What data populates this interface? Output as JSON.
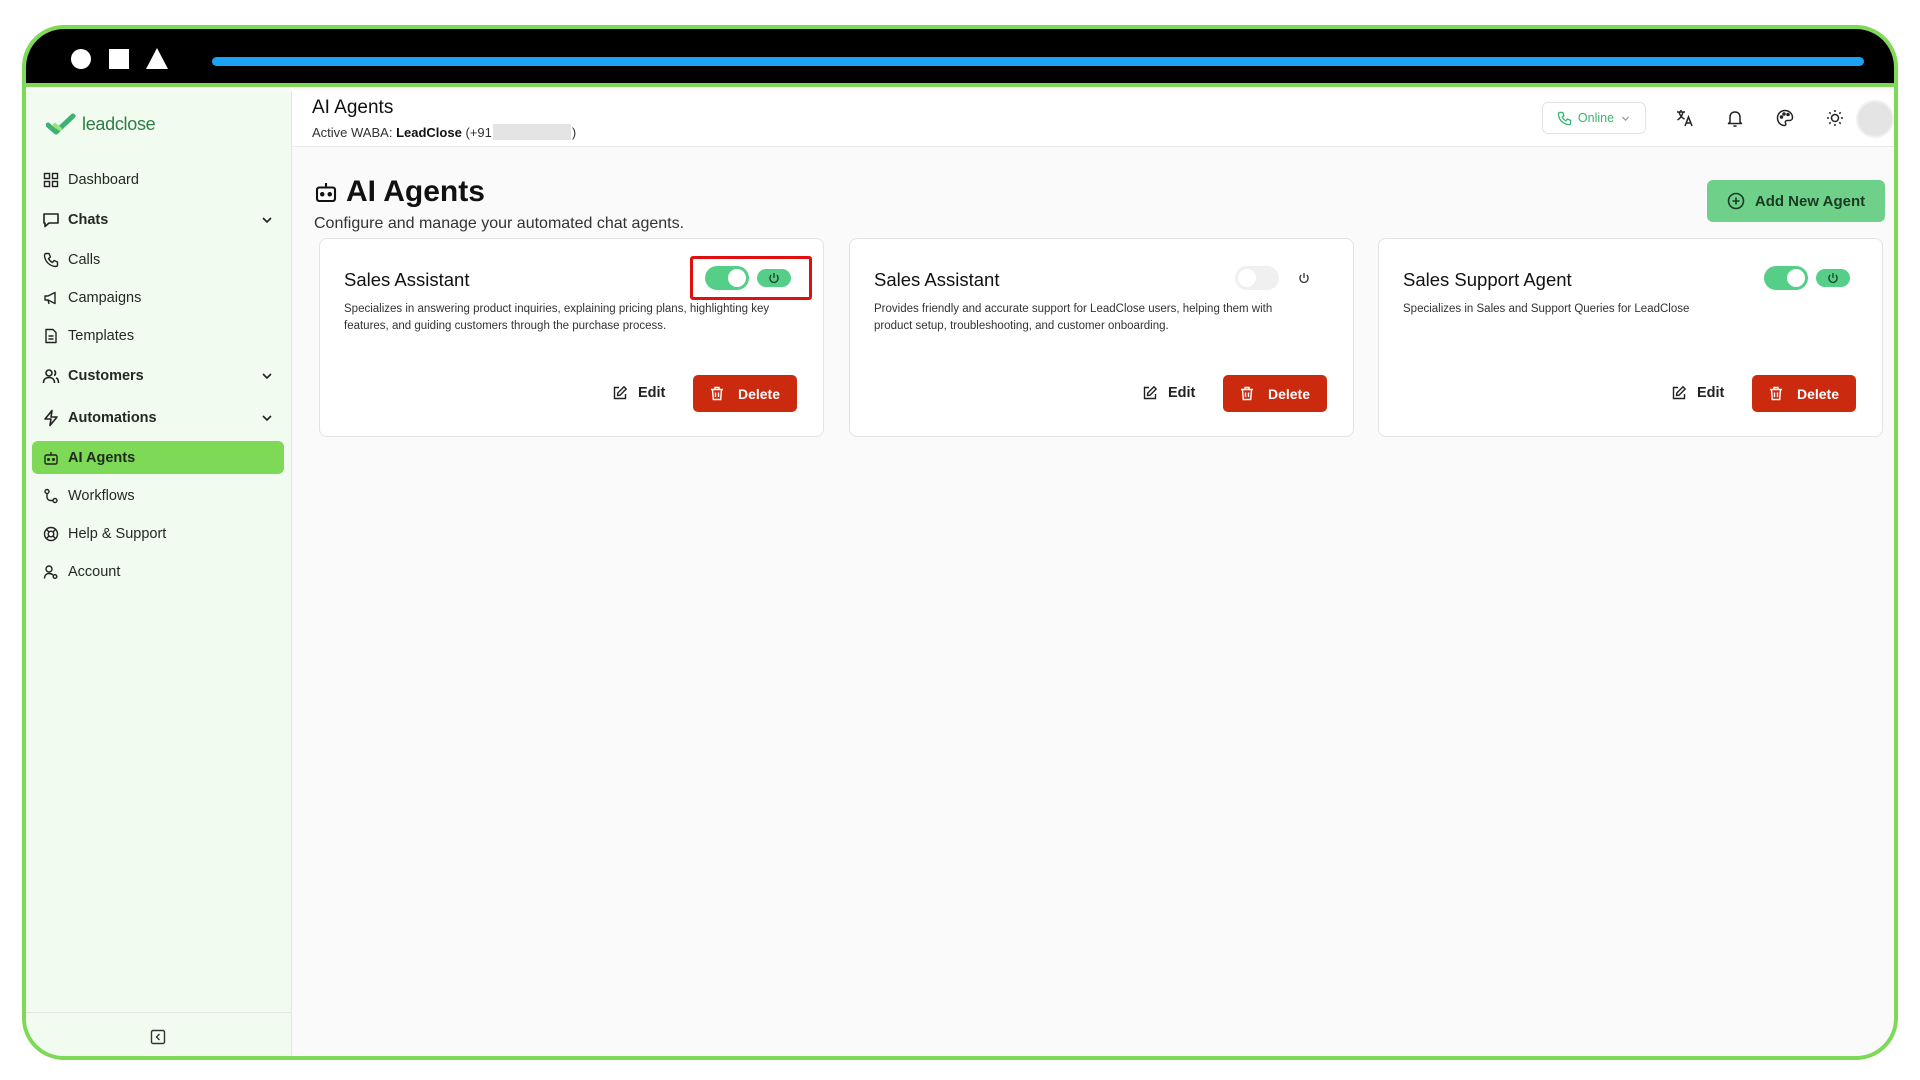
{
  "app": {
    "logo_text": "leadclose"
  },
  "sidebar": {
    "items": [
      {
        "label": "Dashboard",
        "icon": "dashboard-icon"
      },
      {
        "label": "Chats",
        "icon": "chat-icon"
      },
      {
        "label": "Calls",
        "icon": "phone-icon"
      },
      {
        "label": "Campaigns",
        "icon": "megaphone-icon"
      },
      {
        "label": "Templates",
        "icon": "template-icon"
      },
      {
        "label": "Customers",
        "icon": "users-icon"
      },
      {
        "label": "Automations",
        "icon": "lightning-icon"
      },
      {
        "label": "AI Agents",
        "icon": "bot-icon"
      },
      {
        "label": "Workflows",
        "icon": "workflow-icon"
      },
      {
        "label": "Help & Support",
        "icon": "lifebuoy-icon"
      },
      {
        "label": "Account",
        "icon": "user-icon"
      }
    ],
    "active": "AI Agents"
  },
  "header": {
    "title": "AI Agents",
    "waba_prefix": "Active WABA:",
    "waba_name": "LeadClose",
    "waba_phone_prefix": "(+91",
    "waba_phone_suffix": ")",
    "status": "Online"
  },
  "page": {
    "title": "AI Agents",
    "description": "Configure and manage your automated chat agents.",
    "add_button": "Add New Agent"
  },
  "agents": [
    {
      "name": "Sales Assistant",
      "description": "Specializes in answering product inquiries, explaining pricing plans, highlighting key features, and guiding customers through the purchase process.",
      "enabled": true,
      "edit_label": "Edit",
      "delete_label": "Delete"
    },
    {
      "name": "Sales Assistant",
      "description": "Provides friendly and accurate support for LeadClose users, helping them with product setup, troubleshooting, and customer onboarding.",
      "enabled": false,
      "edit_label": "Edit",
      "delete_label": "Delete"
    },
    {
      "name": "Sales Support Agent",
      "description": "Specializes in Sales and Support Queries for LeadClose",
      "enabled": true,
      "edit_label": "Edit",
      "delete_label": "Delete"
    }
  ],
  "colors": {
    "accent": "#7ed957",
    "toggle_on": "#55cf88",
    "delete": "#cc2a0e",
    "online": "#3cb371"
  }
}
